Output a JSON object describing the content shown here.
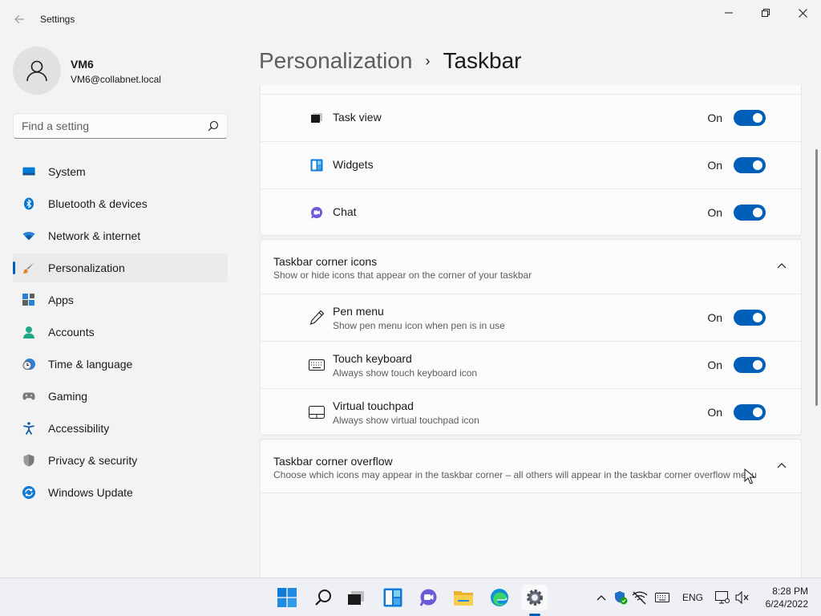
{
  "window": {
    "title": "Settings"
  },
  "profile": {
    "name": "VM6",
    "email": "VM6@collabnet.local"
  },
  "search": {
    "placeholder": "Find a setting"
  },
  "sidebar": {
    "items": [
      {
        "label": "System",
        "icon": "system-icon"
      },
      {
        "label": "Bluetooth & devices",
        "icon": "bluetooth-icon"
      },
      {
        "label": "Network & internet",
        "icon": "wifi-icon"
      },
      {
        "label": "Personalization",
        "icon": "paintbrush-icon",
        "active": true
      },
      {
        "label": "Apps",
        "icon": "apps-icon"
      },
      {
        "label": "Accounts",
        "icon": "accounts-icon"
      },
      {
        "label": "Time & language",
        "icon": "clock-globe-icon"
      },
      {
        "label": "Gaming",
        "icon": "gamepad-icon"
      },
      {
        "label": "Accessibility",
        "icon": "accessibility-icon"
      },
      {
        "label": "Privacy & security",
        "icon": "shield-icon"
      },
      {
        "label": "Windows Update",
        "icon": "update-icon"
      }
    ]
  },
  "breadcrumb": {
    "parent": "Personalization",
    "separator": "›",
    "current": "Taskbar"
  },
  "taskbar_items": {
    "rows": [
      {
        "title": "Task view",
        "state": "On",
        "on": true,
        "icon": "task-view-icon"
      },
      {
        "title": "Widgets",
        "state": "On",
        "on": true,
        "icon": "widgets-icon"
      },
      {
        "title": "Chat",
        "state": "On",
        "on": true,
        "icon": "chat-icon"
      }
    ]
  },
  "corner_icons": {
    "title": "Taskbar corner icons",
    "description": "Show or hide icons that appear on the corner of your taskbar",
    "rows": [
      {
        "title": "Pen menu",
        "description": "Show pen menu icon when pen is in use",
        "state": "On",
        "on": true,
        "icon": "pen-icon"
      },
      {
        "title": "Touch keyboard",
        "description": "Always show touch keyboard icon",
        "state": "On",
        "on": true,
        "icon": "keyboard-icon"
      },
      {
        "title": "Virtual touchpad",
        "description": "Always show virtual touchpad icon",
        "state": "On",
        "on": true,
        "icon": "touchpad-icon"
      }
    ]
  },
  "corner_overflow": {
    "title": "Taskbar corner overflow",
    "description": "Choose which icons may appear in the taskbar corner – all others will appear in the taskbar corner overflow menu"
  },
  "system_taskbar": {
    "apps": [
      "start-icon",
      "search-icon",
      "task-view-icon",
      "widgets-icon",
      "chat-icon",
      "file-explorer-icon",
      "edge-icon",
      "settings-icon"
    ],
    "active_app": "settings-icon",
    "tray": {
      "language": "ENG",
      "time": "8:28 PM",
      "date": "6/24/2022"
    }
  },
  "colors": {
    "accent": "#005fb8",
    "background": "#f3f3f3",
    "card": "#fbfbfb"
  }
}
